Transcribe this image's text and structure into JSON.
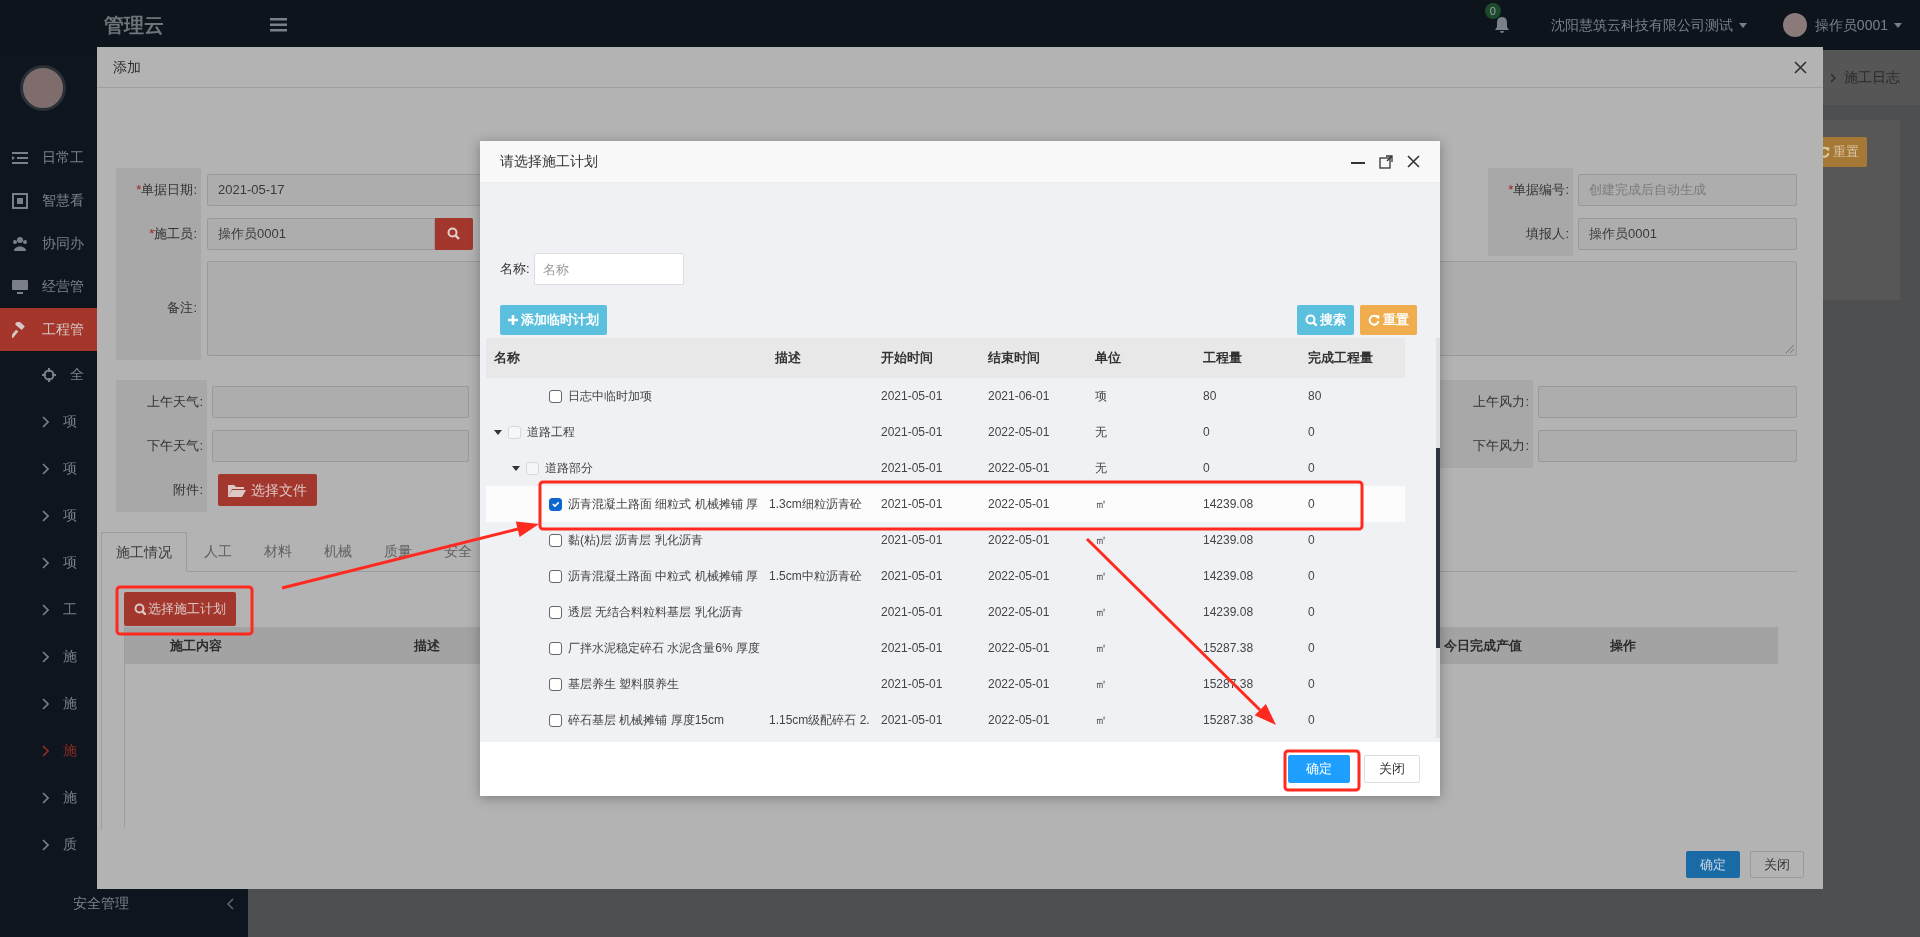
{
  "topbar": {
    "logo": "管理云",
    "notification_count": "0",
    "company": "沈阳慧筑云科技有限公司测试",
    "user": "操作员0001"
  },
  "sidebar": {
    "items": [
      {
        "label": "日常工",
        "kind": "menu",
        "selected": false
      },
      {
        "label": "智慧看",
        "kind": "menu",
        "selected": false
      },
      {
        "label": "协同办",
        "kind": "menu",
        "selected": false
      },
      {
        "label": "经营管",
        "kind": "menu",
        "selected": false
      },
      {
        "label": "工程管",
        "kind": "menu",
        "selected": true
      },
      {
        "label": "全",
        "kind": "sub",
        "selected": false
      },
      {
        "label": "项",
        "kind": "sub",
        "selected": false
      },
      {
        "label": "项",
        "kind": "sub",
        "selected": false
      },
      {
        "label": "项",
        "kind": "sub",
        "selected": false
      },
      {
        "label": "项",
        "kind": "sub",
        "selected": false
      },
      {
        "label": "工",
        "kind": "sub",
        "selected": false
      },
      {
        "label": "施",
        "kind": "sub",
        "selected": false
      },
      {
        "label": "施",
        "kind": "sub",
        "selected": false
      },
      {
        "label": "施",
        "kind": "sub",
        "selected": true
      },
      {
        "label": "施",
        "kind": "sub",
        "selected": false
      },
      {
        "label": "质",
        "kind": "sub",
        "selected": false
      },
      {
        "label": "安全管理",
        "kind": "group",
        "selected": false
      }
    ]
  },
  "breadcrumb": {
    "current": "施工日志"
  },
  "background_reset_button": "重置",
  "add_dialog": {
    "title": "添加",
    "date": {
      "label": "单据日期:",
      "mark": "*",
      "value": "2021-05-17"
    },
    "worker": {
      "label": "施工员:",
      "mark": "*",
      "value": "操作员0001"
    },
    "doc_no": {
      "label": "单据编号:",
      "mark": "*",
      "placeholder": "创建完成后自动生成"
    },
    "reporter": {
      "label": "填报人:",
      "value": "操作员0001"
    },
    "remark": {
      "label": "备注:"
    },
    "weather_am": {
      "label": "上午天气:"
    },
    "weather_pm": {
      "label": "下午天气:"
    },
    "wind_am": {
      "label": "上午风力:"
    },
    "wind_pm": {
      "label": "下午风力:"
    },
    "attachment": {
      "label": "附件:",
      "button": "选择文件"
    },
    "tabs": [
      {
        "label": "施工情况",
        "selected": true
      },
      {
        "label": "人工",
        "selected": false
      },
      {
        "label": "材料",
        "selected": false
      },
      {
        "label": "机械",
        "selected": false
      },
      {
        "label": "质量",
        "selected": false
      },
      {
        "label": "安全",
        "selected": false
      }
    ],
    "select_plan_button": "选择施工计划",
    "table": {
      "columns": [
        "施工内容",
        "描述",
        "今日完成产值",
        "操作"
      ]
    },
    "buttons": [
      {
        "label": "确定",
        "kind": "primary"
      },
      {
        "label": "关闭",
        "kind": "default"
      }
    ]
  },
  "plan_dialog": {
    "title": "请选择施工计划",
    "filter": {
      "label": "名称:",
      "placeholder": "名称"
    },
    "add_button": "添加临时计划",
    "search_button": "搜索",
    "reset_button": "重置",
    "columns": [
      "名称",
      "描述",
      "开始时间",
      "结束时间",
      "单位",
      "工程量",
      "完成工程量"
    ],
    "rows": [
      {
        "children": [
          {
            "children": [
              {
                "name": "日志中临时加项",
                "start": "2021-05-01",
                "end": "2021-06-01",
                "unit": "项",
                "quantity": "80",
                "done": "80",
                "checked": false,
                "disabled": false,
                "selected": false
              }
            ]
          }
        ]
      },
      {
        "name": "道路工程",
        "start": "2021-05-01",
        "end": "2022-05-01",
        "unit": "无",
        "quantity": "0",
        "done": "0",
        "checked": false,
        "disabled": true,
        "selected": false,
        "expanded": true,
        "children": [
          {
            "name": "道路部分",
            "start": "2021-05-01",
            "end": "2022-05-01",
            "unit": "无",
            "quantity": "0",
            "done": "0",
            "checked": false,
            "disabled": true,
            "selected": false,
            "expanded": true,
            "children": [
              {
                "name": "沥青混凝土路面 细粒式 机械摊铺 厚",
                "description": "1.3cm细粒沥青砼",
                "start": "2021-05-01",
                "end": "2022-05-01",
                "unit": "㎡",
                "quantity": "14239.08",
                "done": "0",
                "checked": true,
                "disabled": false,
                "selected": true
              },
              {
                "name": "黏(粘)层 沥青层 乳化沥青",
                "start": "2021-05-01",
                "end": "2022-05-01",
                "unit": "㎡",
                "quantity": "14239.08",
                "done": "0",
                "checked": false,
                "disabled": false,
                "selected": false
              },
              {
                "name": "沥青混凝土路面 中粒式 机械摊铺 厚",
                "description": "1.5cm中粒沥青砼",
                "start": "2021-05-01",
                "end": "2022-05-01",
                "unit": "㎡",
                "quantity": "14239.08",
                "done": "0",
                "checked": false,
                "disabled": false,
                "selected": false
              },
              {
                "name": "透层 无结合料粒料基层 乳化沥青",
                "start": "2021-05-01",
                "end": "2022-05-01",
                "unit": "㎡",
                "quantity": "14239.08",
                "done": "0",
                "checked": false,
                "disabled": false,
                "selected": false
              },
              {
                "name": "厂拌水泥稳定碎石 水泥含量6% 厚度",
                "start": "2021-05-01",
                "end": "2022-05-01",
                "unit": "㎡",
                "quantity": "15287.38",
                "done": "0",
                "checked": false,
                "disabled": false,
                "selected": false
              },
              {
                "name": "基层养生 塑料膜养生",
                "start": "2021-05-01",
                "end": "2022-05-01",
                "unit": "㎡",
                "quantity": "15287.38",
                "done": "0",
                "checked": false,
                "disabled": false,
                "selected": false
              },
              {
                "name": "碎石基层 机械摊铺 厚度15cm",
                "description": "1.15cm级配碎石 2.",
                "start": "2021-05-01",
                "end": "2022-05-01",
                "unit": "㎡",
                "quantity": "15287.38",
                "done": "0",
                "checked": false,
                "disabled": false,
                "selected": false
              }
            ]
          }
        ]
      }
    ],
    "buttons": [
      {
        "label": "确定",
        "kind": "primary"
      },
      {
        "label": "关闭",
        "kind": "default"
      }
    ]
  }
}
